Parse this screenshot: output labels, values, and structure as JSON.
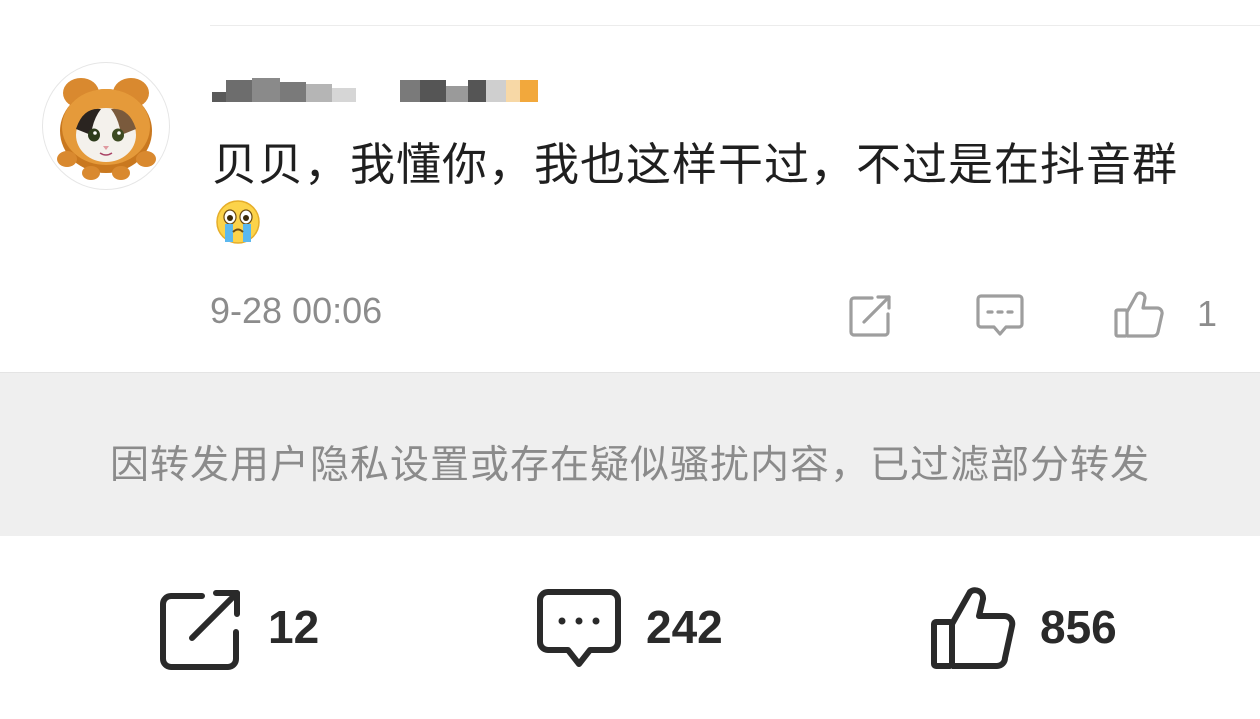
{
  "comment": {
    "text": "贝贝，我懂你，我也这样干过，不过是在抖音群",
    "emoji": "crying-face-emoji",
    "time": "9-28 00:06",
    "like_count": "1"
  },
  "notice": {
    "text": "因转发用户隐私设置或存在疑似骚扰内容，已过滤部分转发"
  },
  "bottom_bar": {
    "share_count": "12",
    "comment_count": "242",
    "like_count": "856"
  },
  "colors": {
    "text_primary": "#1f1f1f",
    "text_secondary": "#8c8c8c",
    "notice_bg": "#efefef",
    "icon_gray": "#a0a0a0",
    "icon_dark": "#2a2a2a"
  },
  "icons": [
    "share-icon",
    "comment-icon",
    "like-icon",
    "reply-icon",
    "message-icon"
  ]
}
